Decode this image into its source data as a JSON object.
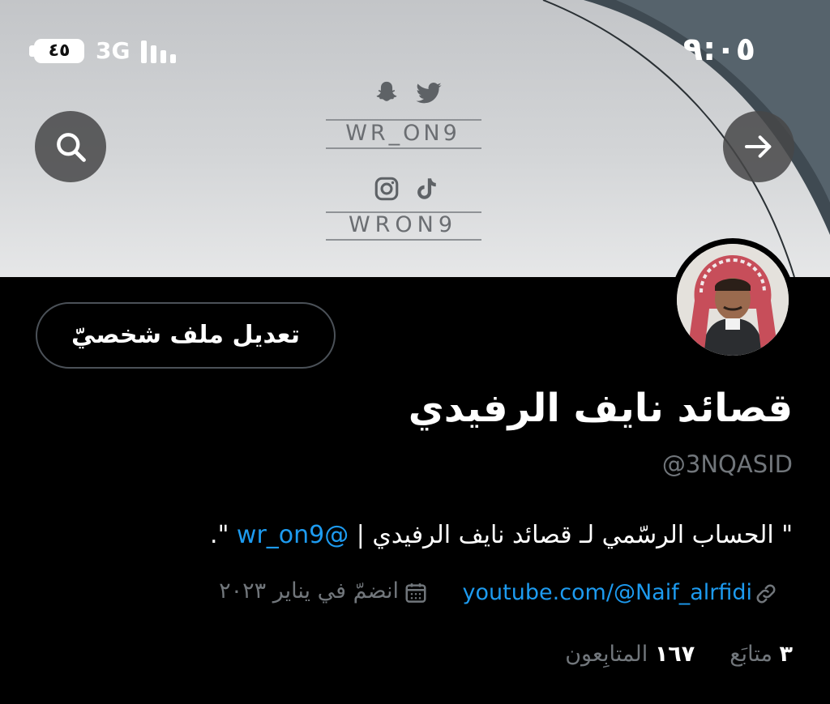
{
  "status_bar": {
    "time": "٩:٠٥",
    "battery": "٤٥",
    "network": "3G"
  },
  "header": {
    "search_icon": "search-icon",
    "back_icon": "arrow-right-icon"
  },
  "banner": {
    "watermark_top": "WR_ON9",
    "watermark_bottom": "WRON9",
    "icons_top": [
      "snapchat-icon",
      "twitter-icon"
    ],
    "icons_bottom": [
      "instagram-icon",
      "tiktok-icon"
    ]
  },
  "profile": {
    "edit_label": "تعديل ملف شخصيّ",
    "name": "قصائد نايف الرفيدي",
    "handle": "@3NQASID",
    "bio_text": "\" الحساب الرسّمي لـ قصائد نايف الرفيدي | ",
    "bio_mention": "@wr_on9",
    "bio_end": " \".",
    "website": "youtube.com/@Naif_alrfidi",
    "joined": "انضمّ في يناير ٢٠٢٣",
    "following_count": "٣",
    "following_label": "متابَع",
    "followers_count": "١٦٧",
    "followers_label": "المتابِعون"
  },
  "colors": {
    "accent": "#1d9bf0",
    "muted": "#71767b",
    "background": "#000000"
  }
}
